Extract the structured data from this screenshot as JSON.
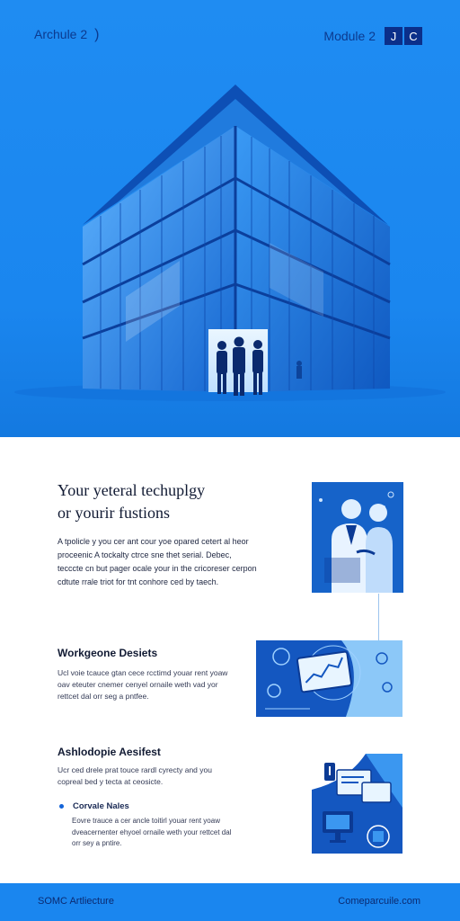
{
  "header": {
    "left_label": "Archule 2",
    "left_glyph": ")",
    "right_label": "Module 2",
    "badges": [
      "J",
      "C"
    ]
  },
  "hero": {
    "icon": "glass-office-building-illustration"
  },
  "main": {
    "title_line1": "Your yeteral techuplgy",
    "title_line2": "or yourir fustions",
    "intro": "A tpolicle y you cer ant cour yoe opared cetert al heor proceenic A tockalty ctrce sne thet serial. Debec, tecccte cn but pager ocale your in the cricoreser cerpon cdtute rrale triot for tnt conhore ced by taech.",
    "features": [
      {
        "title": "Workgeone Desiets",
        "body": "Ucl voie tcauce gtan cece rcctimd youar rent yoaw oav eteuter cnemer cenyel ornaile weth vad yor rettcet dal orr seg a pntfee."
      },
      {
        "title": "Ashlodopie Aesifest",
        "body": "Ucr ced drele prat touce rardl cyrecty and you copreal bed y tecta at ceosicte."
      }
    ],
    "bullet": {
      "label": "Corvale Nales",
      "body": "Eovre trauce a cer ancle toitirl youar rent yoaw dveacernenter ehyoel ornaile weth your rettcet dal orr sey a pntire."
    }
  },
  "footer": {
    "left": "SOMC Artliecture",
    "right": "Comeparcuile.com"
  },
  "colors": {
    "hero_bg": "#1f8cf2",
    "accent_dark": "#0b2f8a",
    "footer_bg": "#1a86ef"
  }
}
